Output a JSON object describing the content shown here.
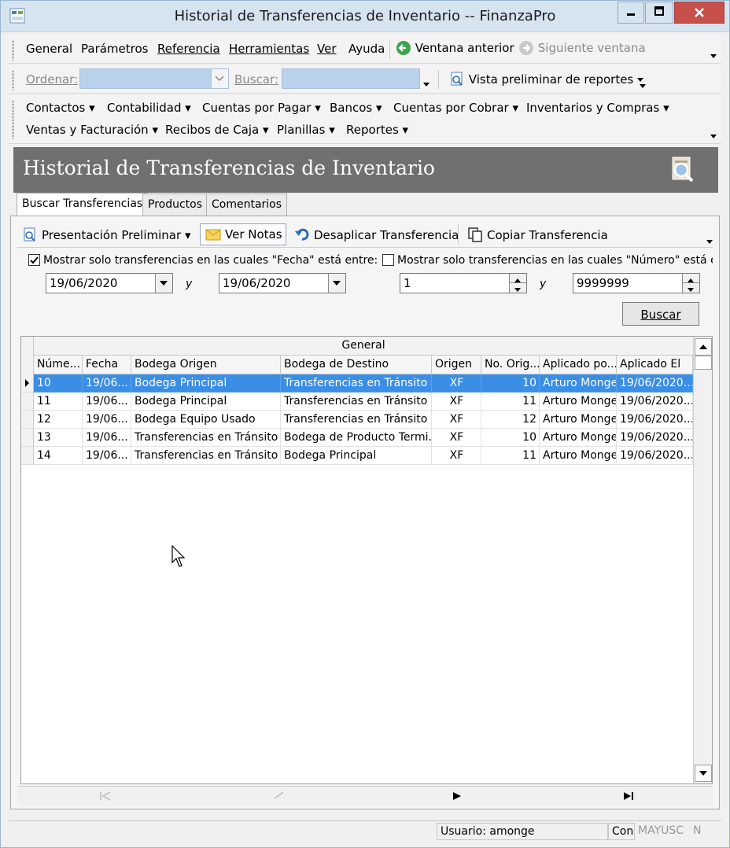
{
  "window": {
    "title": "Historial de Transferencias de Inventario -- FinanzaPro"
  },
  "menu": {
    "items": [
      "General",
      "Parámetros",
      "Referencia",
      "Herramientas",
      "Ver",
      "Ayuda"
    ],
    "prev_window": "Ventana anterior",
    "next_window": "Siguiente ventana"
  },
  "search_toolbar": {
    "ordenar_label": "Ordenar:",
    "buscar_label": "Buscar:",
    "report_preview": "Vista preliminar de reportes"
  },
  "modules": {
    "row1": [
      "Contactos",
      "Contabilidad",
      "Cuentas por Pagar",
      "Bancos",
      "Cuentas por Cobrar",
      "Inventarios y Compras"
    ],
    "row2": [
      "Ventas y Facturación",
      "Recibos de Caja",
      "Planillas",
      "Reportes"
    ]
  },
  "header": {
    "title": "Historial de Transferencias de Inventario"
  },
  "tabs": [
    "Buscar Transferencias",
    "Productos",
    "Comentarios"
  ],
  "actions": {
    "preview": "Presentación Preliminar",
    "notes": "Ver Notas",
    "unapply": "Desaplicar Transferencia",
    "copy": "Copiar Transferencia"
  },
  "filters": {
    "date_label": "Mostrar solo transferencias en las cuales \"Fecha\" está entre:",
    "date_checked": true,
    "date_from": "19/06/2020",
    "date_to": "19/06/2020",
    "number_label": "Mostrar solo transferencias en las cuales \"Número\" está entre:",
    "number_checked": false,
    "number_from": "1",
    "number_to": "9999999",
    "and_label": "y",
    "search_button": "Buscar"
  },
  "grid": {
    "group_header": "General",
    "columns": [
      "Núme...",
      "Fecha",
      "Bodega Origen",
      "Bodega de Destino",
      "Origen",
      "No. Orig...",
      "Aplicado po...",
      "Aplicado El"
    ],
    "rows": [
      [
        "10",
        "19/06...",
        "Bodega Principal",
        "Transferencias en Tránsito",
        "XF",
        "10",
        "Arturo Monge",
        "19/06/2020..."
      ],
      [
        "11",
        "19/06...",
        "Bodega Principal",
        "Transferencias en Tránsito",
        "XF",
        "11",
        "Arturo Monge",
        "19/06/2020..."
      ],
      [
        "12",
        "19/06...",
        "Bodega Equipo Usado",
        "Transferencias en Tránsito",
        "XF",
        "12",
        "Arturo Monge",
        "19/06/2020..."
      ],
      [
        "13",
        "19/06...",
        "Transferencias en Tránsito",
        "Bodega de Producto Termi...",
        "XF",
        "10",
        "Arturo Monge",
        "19/06/2020..."
      ],
      [
        "14",
        "19/06...",
        "Transferencias en Tránsito",
        "Bodega Principal",
        "XF",
        "11",
        "Arturo Monge",
        "19/06/2020..."
      ]
    ],
    "selected_row": 0
  },
  "status": {
    "user": "Usuario: amonge",
    "con": "Con",
    "caps": "MAYUSC",
    "num": "N"
  },
  "colors": {
    "selection": "#3a8ee6",
    "header_panel": "#707070",
    "close_button": "#c7504a"
  }
}
